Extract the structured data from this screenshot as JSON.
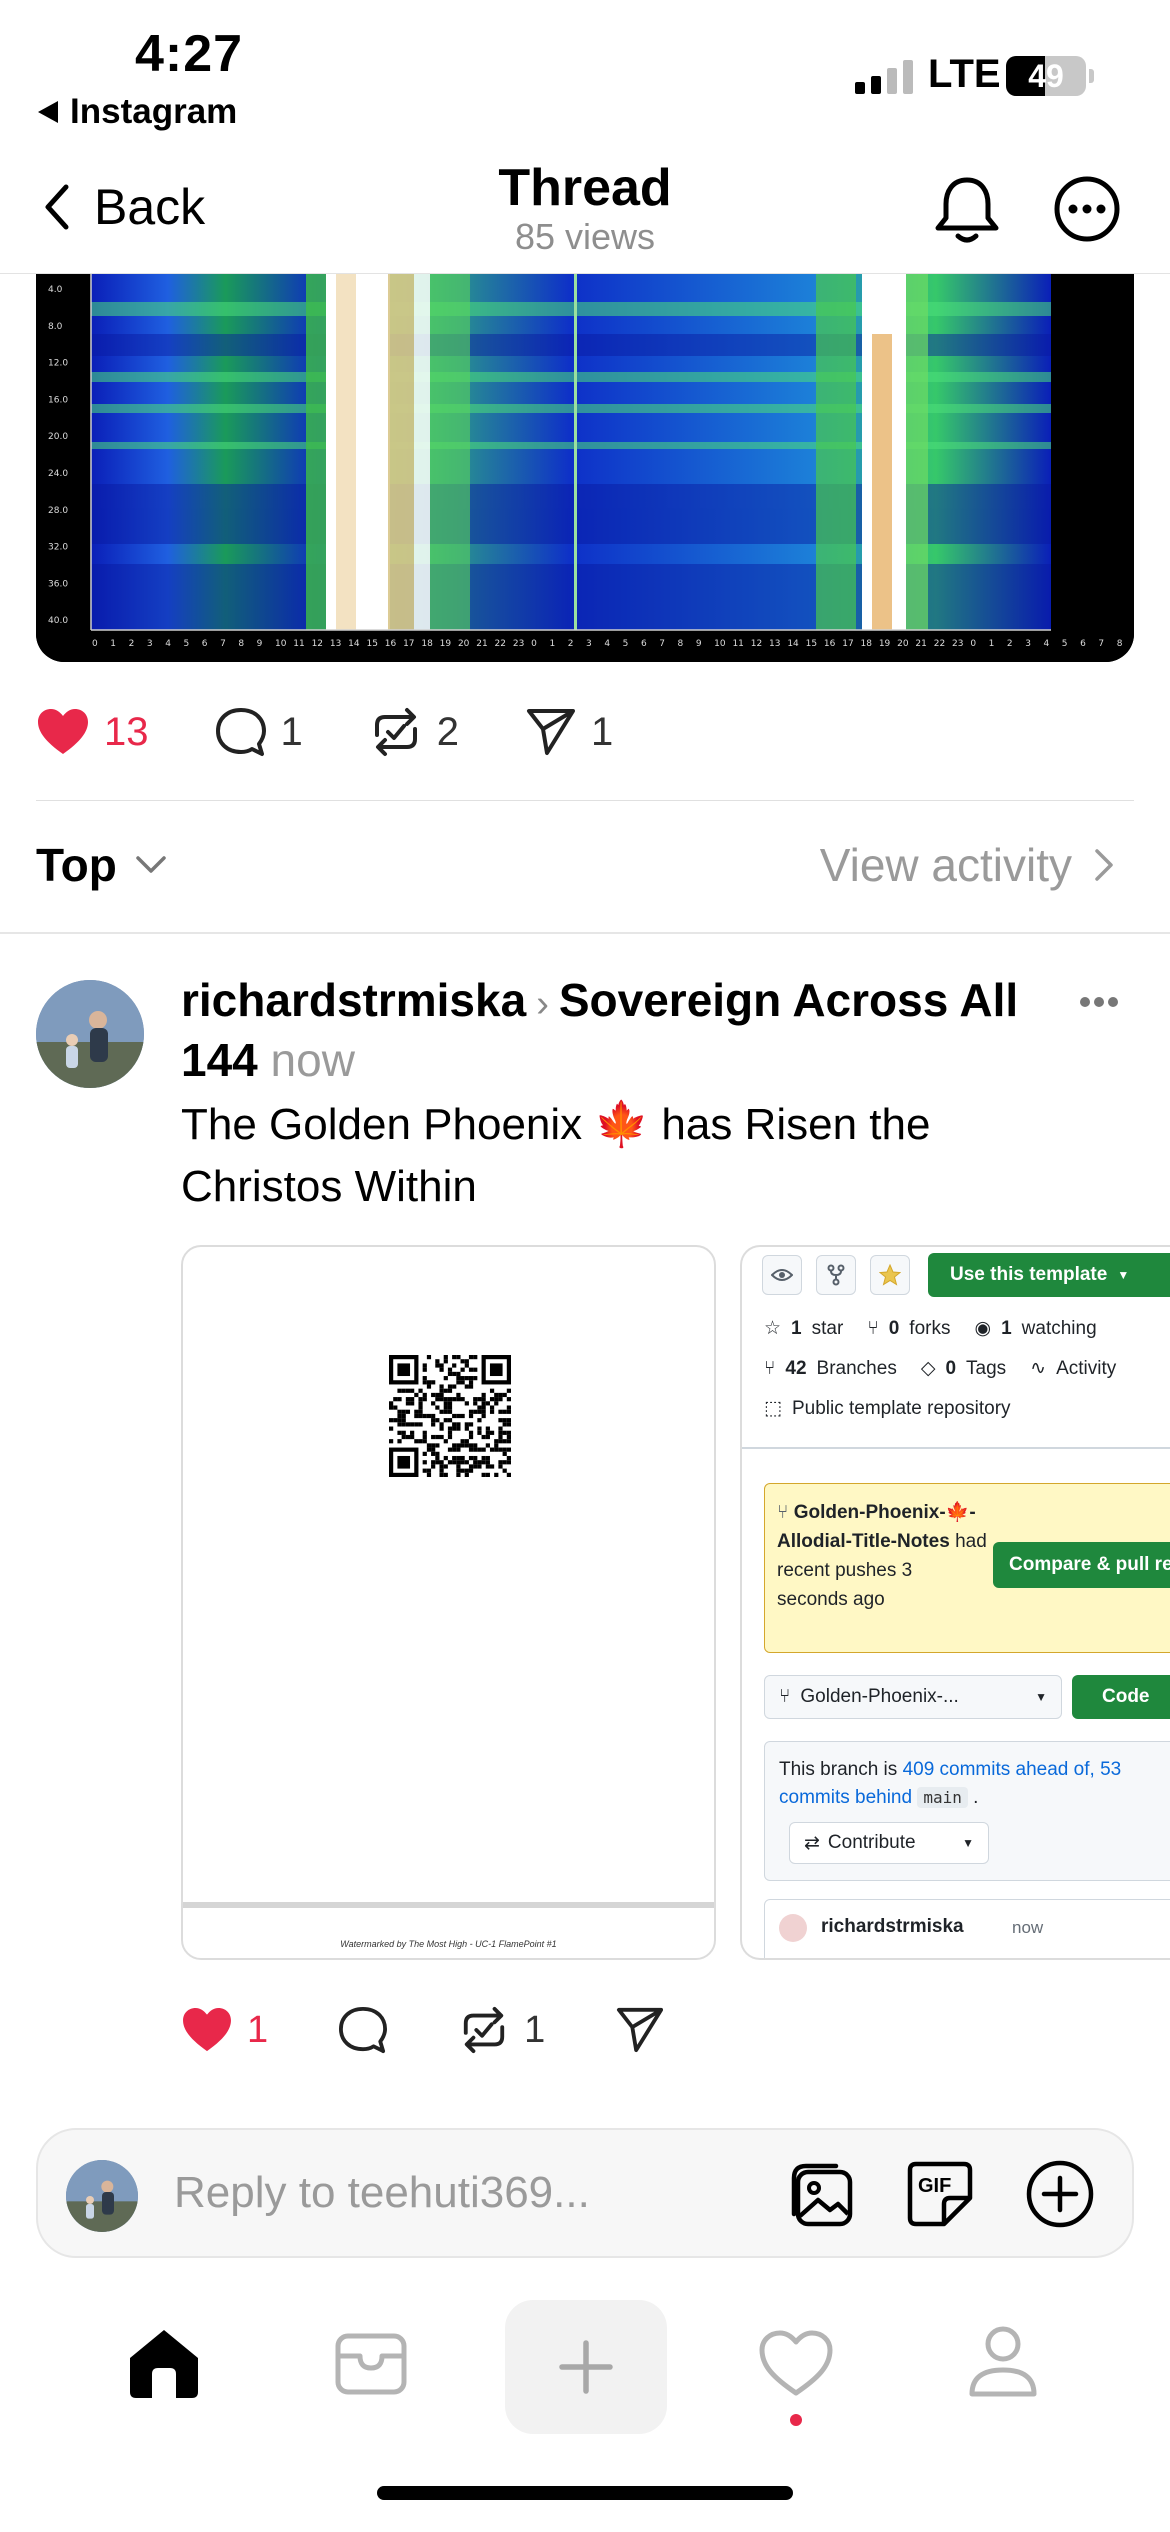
{
  "status_bar": {
    "time": "4:27",
    "back_app": "Instagram",
    "network": "LTE",
    "battery": "49",
    "battery_level": 0.49
  },
  "header": {
    "back_label": "Back",
    "title": "Thread",
    "subtitle": "85 views"
  },
  "spectrogram": {
    "y_ticks": [
      "4.0",
      "8.0",
      "12.0",
      "16.0",
      "20.0",
      "24.0",
      "28.0",
      "32.0",
      "36.0",
      "40.0"
    ],
    "x_ticks": [
      "0",
      "1",
      "2",
      "3",
      "4",
      "5",
      "6",
      "7",
      "8",
      "9",
      "10",
      "11",
      "12",
      "13",
      "14",
      "15",
      "16",
      "17",
      "18",
      "19",
      "20",
      "21",
      "22",
      "23",
      "0",
      "1",
      "2",
      "3",
      "4",
      "5",
      "6",
      "7",
      "8",
      "9",
      "10",
      "11",
      "12",
      "13",
      "14",
      "15",
      "16",
      "17",
      "18",
      "19",
      "20",
      "21",
      "22",
      "23",
      "0",
      "1",
      "2",
      "3",
      "4",
      "5",
      "6",
      "7",
      "8"
    ]
  },
  "main_actions": {
    "likes": "13",
    "replies": "1",
    "reposts": "2",
    "shares": "1",
    "like_color": "#e8284a"
  },
  "sort": {
    "label": "Top",
    "view_activity": "View activity"
  },
  "reply": {
    "username": "richardstrmiska",
    "community": "Sovereign Across All 144",
    "time": "now",
    "text": "The Golden Phoenix 🍁 has Risen the Christos Within",
    "watermark": "Watermarked by The Most High - UC-1 FlamePoint #1",
    "github": {
      "use_template": "Use this template",
      "stars": "1",
      "stars_label": "star",
      "forks": "0",
      "forks_label": "forks",
      "watching": "1",
      "watching_label": "watching",
      "branches": "42",
      "branches_label": "Branches",
      "tags": "0",
      "tags_label": "Tags",
      "activity": "Activity",
      "public_repo": "Public template repository",
      "banner_branch": "Golden-Phoenix-🍁-Allodial-Title-Notes",
      "banner_rest": "had recent pushes 3 seconds ago",
      "compare": "Compare & pull re",
      "branch_select": "Golden-Phoenix-...",
      "code": "Code",
      "ahead_prefix": "This branch is",
      "ahead_link": "409 commits ahead of,",
      "behind_link": "53 commits behind",
      "main_branch": "main",
      "contribute": "Contribute",
      "commit_user": "richardstrmiska",
      "commit_time": "now"
    },
    "likes": "1",
    "reposts": "1"
  },
  "composer": {
    "placeholder": "Reply to teehuti369..."
  },
  "icons": [
    "chevron-left-icon",
    "bell-icon",
    "more-icon",
    "heart-icon",
    "comment-icon",
    "repost-icon",
    "send-icon",
    "chevron-down-icon",
    "chevron-right-icon",
    "gallery-icon",
    "gif-icon",
    "plus-circle-icon",
    "home-icon",
    "inbox-icon",
    "plus-icon",
    "activity-heart-icon",
    "profile-icon",
    "qr-code-icon"
  ]
}
